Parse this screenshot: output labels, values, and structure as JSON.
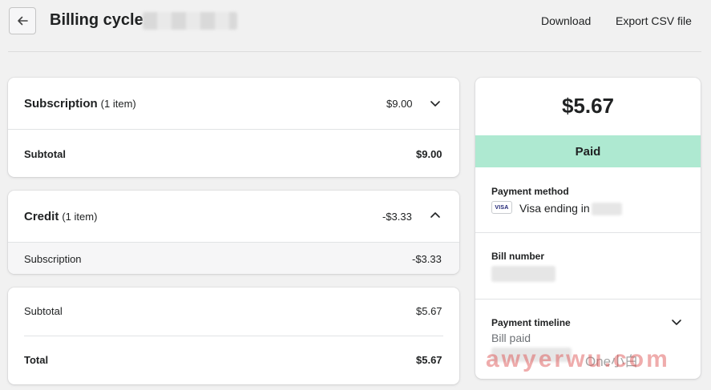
{
  "header": {
    "title": "Billing cycle:",
    "actions": {
      "download": "Download",
      "export_csv": "Export CSV file"
    }
  },
  "subscription_card": {
    "title": "Subscription",
    "count": "(1 item)",
    "amount": "$9.00",
    "subtotal_label": "Subtotal",
    "subtotal_amount": "$9.00"
  },
  "credit_card": {
    "title": "Credit",
    "count": "(1 item)",
    "amount": "-$3.33",
    "item_label": "Subscription",
    "item_amount": "-$3.33"
  },
  "totals_card": {
    "subtotal_label": "Subtotal",
    "subtotal_amount": "$5.67",
    "total_label": "Total",
    "total_amount": "$5.67"
  },
  "summary": {
    "amount": "$5.67",
    "status": "Paid",
    "status_color": "#aee9d1",
    "payment_method_label": "Payment method",
    "card_brand": "VISA",
    "card_text": "Visa ending in",
    "bill_number_label": "Bill number",
    "timeline_label": "Payment timeline",
    "timeline_item": "Bill paid"
  },
  "watermark": {
    "brand": "awyerwu.com",
    "tag": "One小白"
  }
}
